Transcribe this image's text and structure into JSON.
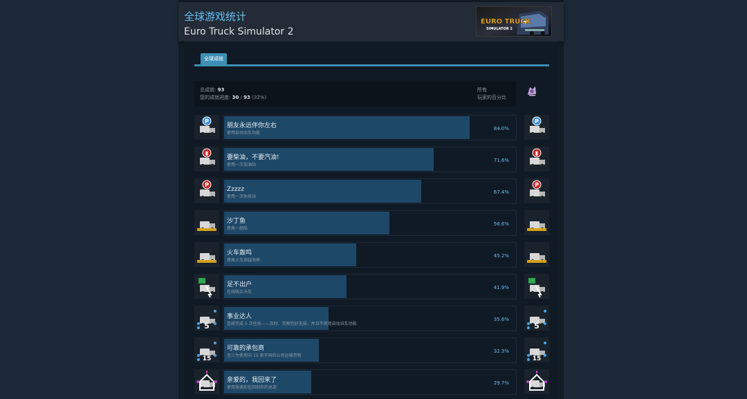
{
  "header": {
    "title": "全球游戏统计",
    "game": "Euro Truck Simulator 2",
    "logo_text": "EURO TRUCK",
    "logo_sub": "SIMULATOR 2"
  },
  "tabs": [
    {
      "label": "全球成就",
      "active": true
    }
  ],
  "summary": {
    "total_label": "总成就:",
    "total": "93",
    "progress_label": "您的成就进度:",
    "progress_done": "30",
    "progress_sep": " / ",
    "progress_total": "93",
    "progress_pct": " (32%)",
    "right_line1": "所有",
    "right_line2": "玩家的百分比"
  },
  "achievements": [
    {
      "name": "朋友永远伴你左右",
      "desc": "使用自动泊车功能",
      "pct": 84.0,
      "pct_label": "84.0%",
      "icon": "truck-parking-icon",
      "badge": "P",
      "badge_color": "#3d8fd6",
      "truck_color": "#d8d8d8"
    },
    {
      "name": "要柴油，不要汽油!",
      "desc": "使用一次加油站",
      "pct": 71.6,
      "pct_label": "71.6%",
      "icon": "truck-fuel-icon",
      "badge": "⛽",
      "badge_color": "#c62828",
      "truck_color": "#d8d8d8"
    },
    {
      "name": "Zzzzz",
      "desc": "使用一次休息站",
      "pct": 67.4,
      "pct_label": "67.4%",
      "icon": "truck-rest-icon",
      "badge": "P",
      "badge_color": "#c62828",
      "truck_color": "#d8d8d8"
    },
    {
      "name": "沙丁鱼",
      "desc": "搭乘一趟船",
      "pct": 56.6,
      "pct_label": "56.6%",
      "icon": "truck-ferry-icon",
      "badge": "",
      "badge_color": "#d6a21e",
      "truck_color": "#d8d8d8"
    },
    {
      "name": "火车轰鸣",
      "desc": "搭乘火车穿越海峡",
      "pct": 45.2,
      "pct_label": "45.2%",
      "icon": "truck-train-icon",
      "badge": "",
      "badge_color": "#d6a21e",
      "truck_color": "#d8d8d8"
    },
    {
      "name": "足不出户",
      "desc": "在线购买卡车",
      "pct": 41.9,
      "pct_label": "41.9%",
      "icon": "truck-buy-icon",
      "badge": "",
      "badge_color": "#2fa84f",
      "truck_color": "#d8d8d8"
    },
    {
      "name": "事业达人",
      "desc": "连续完成 5 次任务——及时、货物完好无损，并且不使用自动泊车功能",
      "pct": 35.6,
      "pct_label": "35.6%",
      "icon": "career-five-icon",
      "badge": "5",
      "badge_color": "#4aa3e0",
      "truck_color": "#d8d8d8"
    },
    {
      "name": "可靠的承包商",
      "desc": "至少为使用中 15 家不同的公司运输货物",
      "pct": 32.3,
      "pct_label": "32.3%",
      "icon": "contractor-fifteen-icon",
      "badge": "15",
      "badge_color": "#4aa3e0",
      "truck_color": "#d8d8d8"
    },
    {
      "name": "亲爱的，我回来了",
      "desc": "使用快速前往回到你的总部",
      "pct": 29.7,
      "pct_label": "29.7%",
      "icon": "home-garage-icon",
      "badge": "",
      "badge_color": "#c03fd0",
      "truck_color": "#d8d8d8"
    }
  ]
}
